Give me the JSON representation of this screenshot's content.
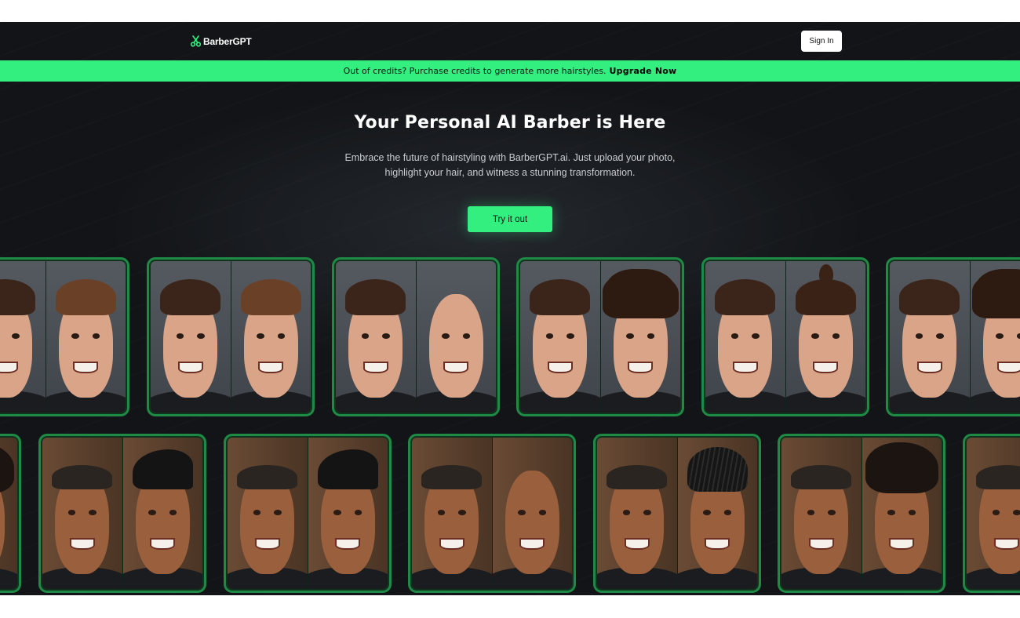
{
  "header": {
    "logo_text": "BarberGPT",
    "signin_label": "Sign In"
  },
  "banner": {
    "message": "Out of credits? Purchase credits to generate more hairstyles.",
    "cta": "Upgrade Now"
  },
  "hero": {
    "title": "Your Personal AI Barber is Here",
    "subtitle_line1": "Embrace the future of hairstyling with BarberGPT.ai. Just upload your photo,",
    "subtitle_line2": "highlight your hair, and witness a stunning transformation.",
    "cta_label": "Try it out"
  },
  "colors": {
    "accent": "#33ef7f",
    "background": "#121417",
    "card_border": "#1f8a45"
  },
  "gallery": {
    "row1_styles": [
      "brown",
      "swept-brown",
      "bald",
      "curly",
      "bun",
      "curly"
    ],
    "row2_styles": [
      "afro",
      "swept",
      "swept",
      "bald",
      "locs",
      "afro",
      "buzz"
    ]
  }
}
